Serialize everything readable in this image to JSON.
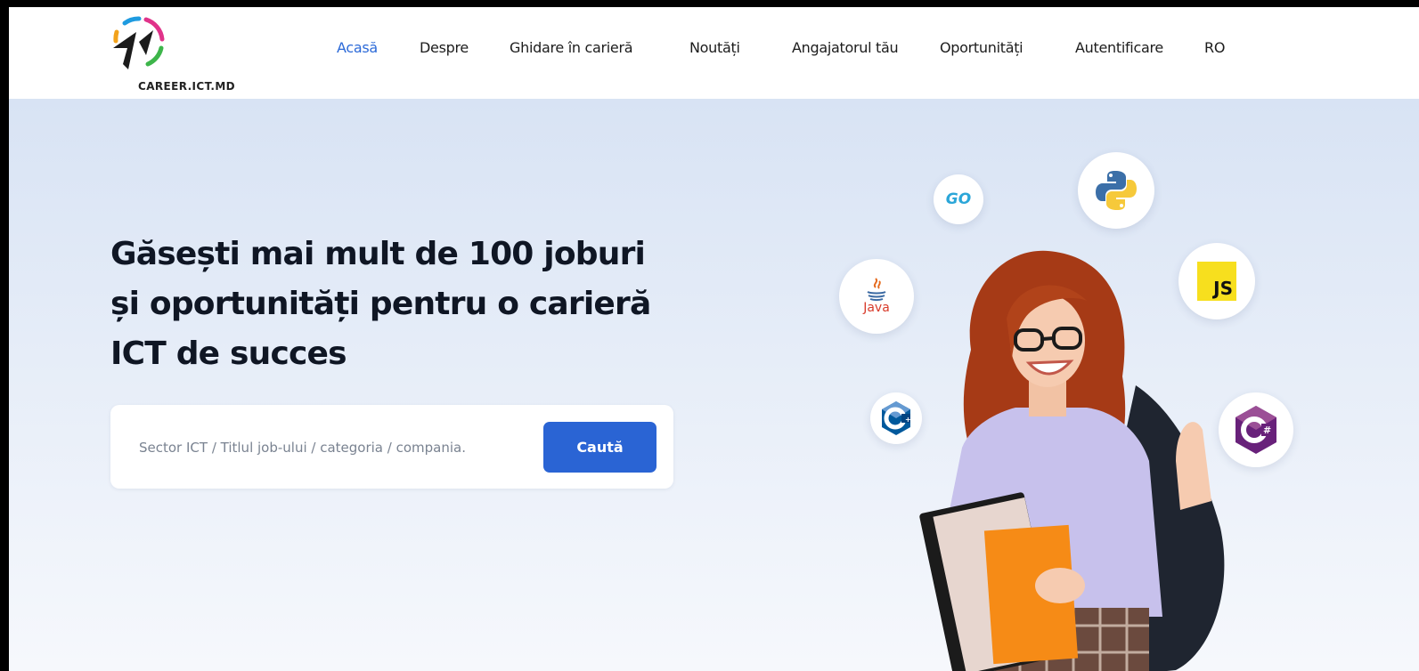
{
  "brand": {
    "logo_text": "CAREER.ICT.MD",
    "colors": {
      "accent": "#2c6ad8",
      "button": "#2a64d4",
      "heading": "#0f1624"
    }
  },
  "nav": {
    "items": [
      {
        "label": "Acasă",
        "active": true
      },
      {
        "label": "Despre",
        "active": false
      },
      {
        "label": "Ghidare în carieră",
        "active": false
      },
      {
        "label": "Noutăți",
        "active": false
      },
      {
        "label": "Angajatorul tău",
        "active": false
      },
      {
        "label": "Oportunități",
        "active": false
      },
      {
        "label": "Autentificare",
        "active": false
      },
      {
        "label": "RO",
        "active": false
      }
    ]
  },
  "hero": {
    "headline": "Găsești mai mult de 100 joburi și oportunități pentru o carieră ICT de succes",
    "search": {
      "placeholder": "Sector ICT / Titlul job-ului / categoria / compania.",
      "button_label": "Caută"
    },
    "tech_badges": {
      "go": "GO",
      "java": "Java",
      "js": "JS"
    },
    "icons": [
      "go-logo-icon",
      "python-logo-icon",
      "java-logo-icon",
      "javascript-logo-icon",
      "cpp-logo-icon",
      "csharp-logo-icon"
    ]
  }
}
